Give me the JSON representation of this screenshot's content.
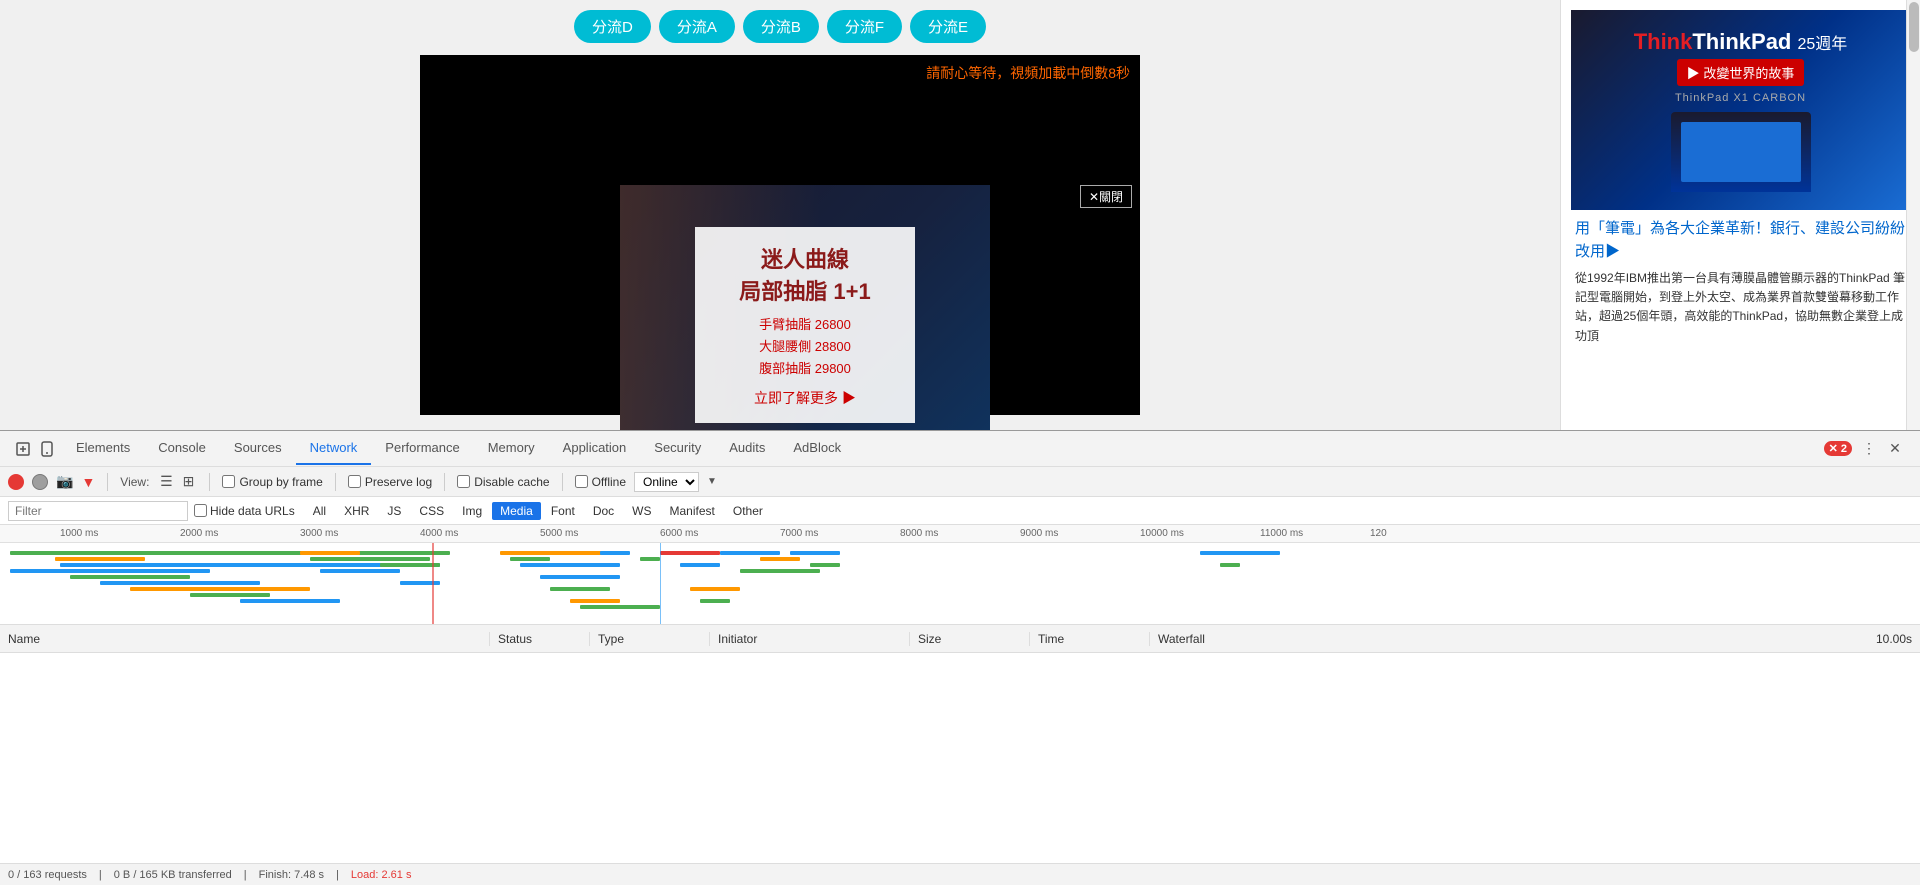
{
  "page": {
    "stream_buttons": [
      "分流D",
      "分流A",
      "分流B",
      "分流F",
      "分流E"
    ],
    "video": {
      "countdown_text": "請耐心等待，視頻加載中倒數",
      "countdown_num": "8",
      "countdown_unit": "秒",
      "close_btn": "✕關閉"
    },
    "ad_overlay": {
      "title": "迷人曲線",
      "subtitle": "局部抽脂 1+1",
      "price1_label": "手臂抽脂",
      "price1": "26800",
      "price2_label": "大腿腰側",
      "price2": "28800",
      "price3_label": "腹部抽脂",
      "price3": "29800",
      "cta": "立即了解更多 ▶"
    },
    "thinkpad": {
      "brand": "ThinkPad",
      "anniversary": "25週年",
      "model_label": "ThinkPad X1 CARBON",
      "tagline_icon": "▶",
      "tagline_text": "改變世界的故事",
      "headline": "用「筆電」為各大企業革新！銀行、建設公司紛紛改用▶",
      "body": "從1992年IBM推出第一台具有薄膜晶體管顯示器的ThinkPad 筆記型電腦開始，到登上外太空、成為業界首款雙螢幕移動工作站，超過25個年頭，高效能的ThinkPad，協助無數企業登上成功頂"
    }
  },
  "devtools": {
    "tabs": [
      {
        "label": "Elements"
      },
      {
        "label": "Console"
      },
      {
        "label": "Sources"
      },
      {
        "label": "Network"
      },
      {
        "label": "Performance"
      },
      {
        "label": "Memory"
      },
      {
        "label": "Application"
      },
      {
        "label": "Security"
      },
      {
        "label": "Audits"
      },
      {
        "label": "AdBlock"
      }
    ],
    "active_tab": "Network",
    "toolbar": {
      "view_label": "View:",
      "group_by_frame": "Group by frame",
      "preserve_log": "Preserve log",
      "disable_cache": "Disable cache",
      "offline": "Offline",
      "online": "Online"
    },
    "filter": {
      "placeholder": "Filter",
      "hide_data_urls": "Hide data URLs",
      "types": [
        "All",
        "XHR",
        "JS",
        "CSS",
        "Img",
        "Media",
        "Font",
        "Doc",
        "WS",
        "Manifest",
        "Other"
      ],
      "active_type": "Media"
    },
    "timeline": {
      "marks": [
        "1000 ms",
        "2000 ms",
        "3000 ms",
        "4000 ms",
        "5000 ms",
        "6000 ms",
        "7000 ms",
        "8000 ms",
        "9000 ms",
        "10000 ms",
        "11000 ms",
        "120"
      ]
    },
    "table": {
      "columns": [
        "Name",
        "Status",
        "Type",
        "Initiator",
        "Size",
        "Time",
        "Waterfall"
      ],
      "waterfall_scale": "10.00s"
    },
    "status_bar": {
      "requests": "0 / 163 requests",
      "transferred": "0 B / 165 KB transferred",
      "finish": "Finish: 7.48 s",
      "load": "Load: 2.61 s"
    }
  }
}
